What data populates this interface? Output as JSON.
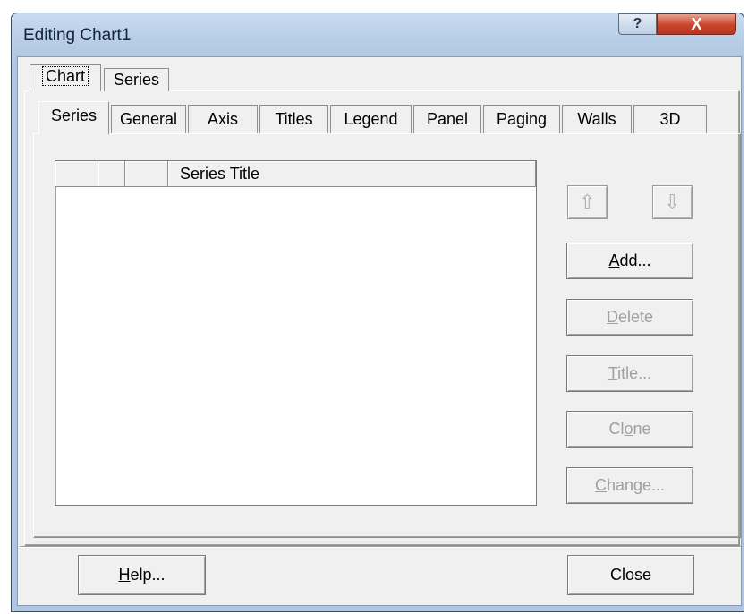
{
  "window": {
    "title": "Editing Chart1",
    "help_glyph": "?",
    "close_glyph": "X"
  },
  "outer_tabs": [
    "Chart",
    "Series"
  ],
  "inner_tabs": [
    "Series",
    "General",
    "Axis",
    "Titles",
    "Legend",
    "Panel",
    "Paging",
    "Walls",
    "3D"
  ],
  "series_list": {
    "header_title": "Series Title",
    "rows": []
  },
  "buttons": {
    "move_up_glyph": "⇧",
    "move_down_glyph": "⇩",
    "add": {
      "pre": "",
      "u": "A",
      "post": "dd..."
    },
    "delete": {
      "pre": "",
      "u": "D",
      "post": "elete"
    },
    "title": {
      "pre": "",
      "u": "T",
      "post": "itle..."
    },
    "clone": {
      "pre": "Cl",
      "u": "o",
      "post": "ne"
    },
    "change": {
      "pre": "",
      "u": "C",
      "post": "hange..."
    },
    "help": {
      "pre": "",
      "u": "H",
      "post": "elp..."
    },
    "close": "Close"
  },
  "colors": {
    "title_close_red": "#c8432a",
    "frame_blue": "#aec6e2",
    "disabled_text": "#a0a0a0"
  }
}
